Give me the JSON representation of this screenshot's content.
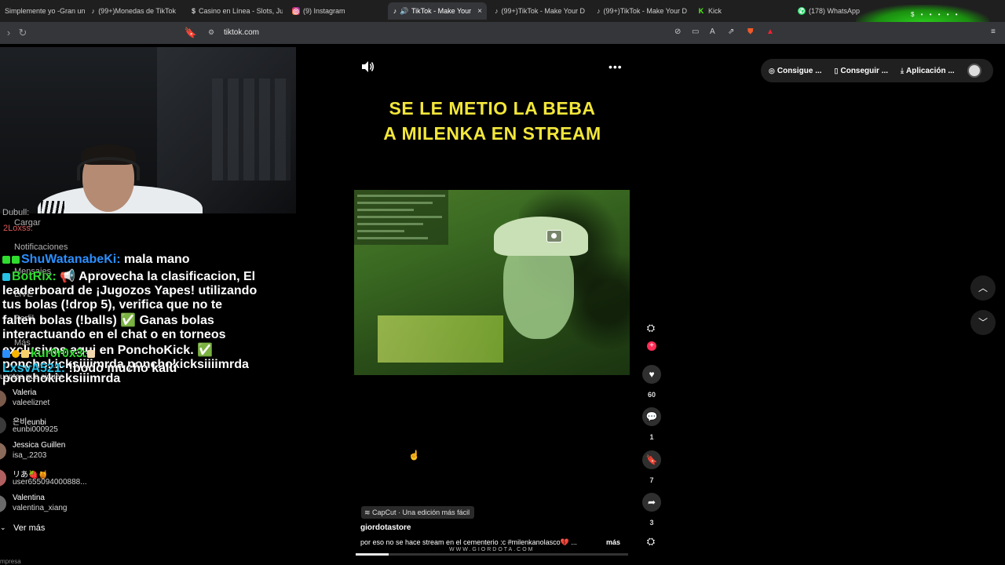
{
  "browser": {
    "tabs": [
      {
        "label": "Simplemente yo -Gran un",
        "icon": "none-icon",
        "active": false
      },
      {
        "label": "(99+)Monedas de TikTok",
        "icon": "tiktok-icon",
        "active": false
      },
      {
        "label": "Casino en Línea - Slots, Ju",
        "icon": "dollar-icon",
        "active": false
      },
      {
        "label": "(9) Instagram",
        "icon": "instagram-icon",
        "active": false
      },
      {
        "label": "TikTok - Make Your",
        "icon": "tiktok-icon",
        "active": true
      },
      {
        "label": "(99+)TikTok - Make Your D",
        "icon": "tiktok-icon",
        "active": false
      },
      {
        "label": "(99+)TikTok - Make Your D",
        "icon": "tiktok-icon",
        "active": false
      },
      {
        "label": "Kick",
        "icon": "kick-icon",
        "active": false
      },
      {
        "label": "(178) WhatsApp",
        "icon": "whatsapp-icon",
        "active": false
      }
    ],
    "close_glyph": "×",
    "url": "tiktok.com",
    "blob_dots": "$ • • • • •"
  },
  "stream_chat": {
    "lines": [
      {
        "user": "ShuWatanabeKi:",
        "message": " mala mano"
      },
      {
        "user": "BotRix:",
        "message": " 📢 Aprovecha la clasificacion, El leaderboard de ¡Jugozos Yapes! utilizando tus bolas (!drop 5), verifica que no te falten bolas (!balls) ✅ Ganas bolas interactuando en el chat o en torneos exclusivos aqui en PonchoKick. ✅ ponchokicksiiiimrda ponchokicksiiiimrda ponchokicksiiimrda"
      },
      {
        "user": "kur0r0x3:",
        "message": ""
      },
      {
        "user": "LxsvA521:",
        "message": " !bodo mucho kalú"
      }
    ],
    "ghost_labels": [
      "Dubull:",
      "Cargar",
      "2Loxss:",
      "Notificaciones",
      "Mensajes",
      "LIVE",
      "Perfil",
      "Más"
    ]
  },
  "sidebar": {
    "following_header": "uentas que sigues",
    "following": [
      {
        "name": "Valeria",
        "handle": "valeeliznet"
      },
      {
        "name": "은비eunbi",
        "handle": "eunbi000925"
      },
      {
        "name": "Jessica Guillen",
        "handle": "isa_.2203"
      },
      {
        "name": "リあ🍓🍯",
        "handle": "user655094000888..."
      },
      {
        "name": "Valentina",
        "handle": "valentina_xiang"
      }
    ],
    "see_more": "Ver más",
    "footer": "mpresa"
  },
  "video": {
    "headline_line1": "SE LE METIO LA BEBA",
    "headline_line2": "A MILENKA EN STREAM",
    "more_glyph": "•••",
    "capcut_label": "CapCut · Una edición más fácil",
    "author": "giordotastore",
    "caption": "por eso no se  hace stream en el cementerio :c #milenkanolasco💔 ...",
    "caption_more": "más",
    "watermark": "WWW.GIORDOTA.COM",
    "progress_fraction": 0.12
  },
  "actions": {
    "like_count": "60",
    "comment_count": "1",
    "save_count": "7",
    "share_count": "3",
    "follow_plus": "+"
  },
  "header_pills": {
    "coins": "Consigue ...",
    "get": "Conseguir ...",
    "app": "Aplicación ..."
  },
  "colors": {
    "headline": "#f2e63a",
    "follow_plus": "#fe2c55",
    "chat_user_blue": "#2b8fff",
    "chat_user_green": "#2fdc2f"
  }
}
